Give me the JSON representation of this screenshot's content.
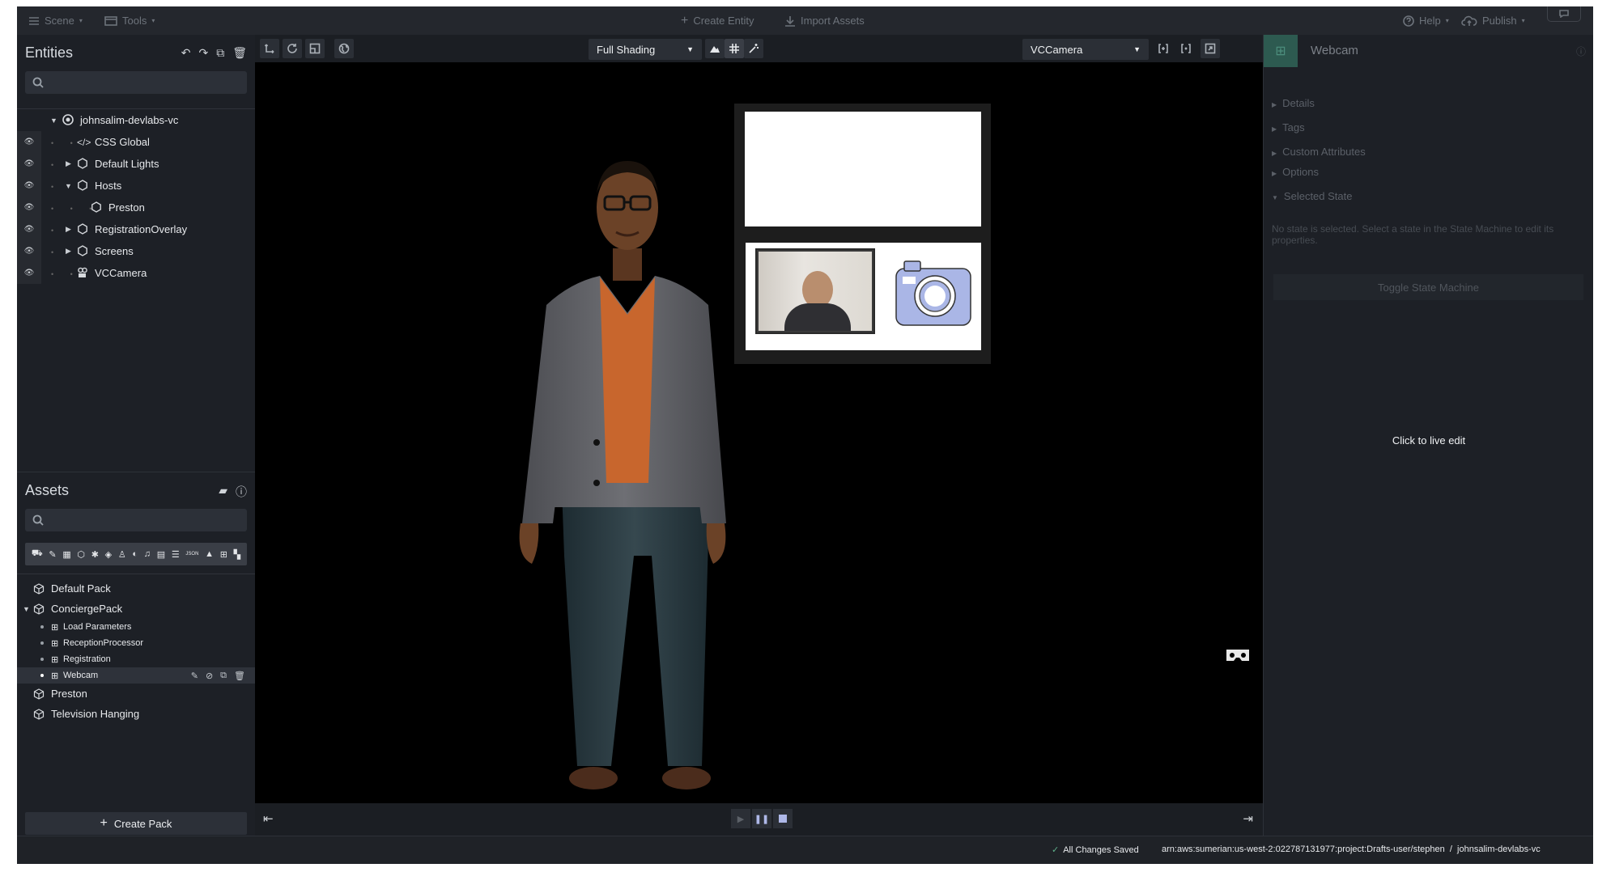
{
  "topbar": {
    "scene": "Scene",
    "tools": "Tools",
    "create_entity": "Create Entity",
    "import_assets": "Import Assets",
    "help": "Help",
    "publish": "Publish"
  },
  "entities": {
    "title": "Entities",
    "items": [
      {
        "label": "johnsalim-devlabs-vc",
        "icon": "scene-icon"
      },
      {
        "label": "CSS Global",
        "icon": "code-icon"
      },
      {
        "label": "Default Lights",
        "icon": "hexagon-icon"
      },
      {
        "label": "Hosts",
        "icon": "hexagon-icon"
      },
      {
        "label": "Preston",
        "icon": "hexagon-icon"
      },
      {
        "label": "RegistrationOverlay",
        "icon": "hexagon-icon"
      },
      {
        "label": "Screens",
        "icon": "hexagon-icon"
      },
      {
        "label": "VCCamera",
        "icon": "camera-icon"
      }
    ]
  },
  "assets": {
    "title": "Assets",
    "items": [
      {
        "label": "Default Pack"
      },
      {
        "label": "ConciergePack"
      },
      {
        "label": "Load Parameters"
      },
      {
        "label": "ReceptionProcessor"
      },
      {
        "label": "Registration"
      },
      {
        "label": "Webcam"
      },
      {
        "label": "Preston"
      },
      {
        "label": "Television Hanging"
      }
    ],
    "create_pack": "Create Pack"
  },
  "viewport": {
    "shading": "Full Shading",
    "camera": "VCCamera"
  },
  "inspector": {
    "title": "Webcam",
    "sections": [
      "Details",
      "Tags",
      "Custom Attributes",
      "Options",
      "Selected State"
    ],
    "no_state_message": "No state is selected. Select a state in the State Machine to edit its properties.",
    "toggle_button": "Toggle State Machine",
    "live_edit": "Click to live edit"
  },
  "status": {
    "saved": "All Changes Saved",
    "path": "arn:aws:sumerian:us-west-2:022787131977:project:Drafts-user/stephen  /  johnsalim-devlabs-vc"
  },
  "colors": {
    "app_bg": "#1b1e23",
    "panel_bg": "#1d2026",
    "accent_green": "#2d5a50",
    "camera_icon": "#aab6e6"
  }
}
